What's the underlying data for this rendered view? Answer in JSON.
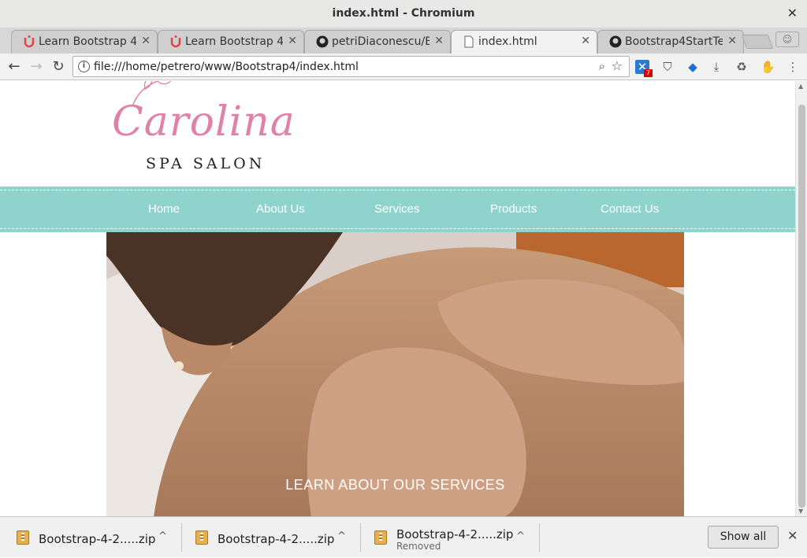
{
  "window": {
    "title": "index.html - Chromium",
    "close_glyph": "✕"
  },
  "tabs": [
    {
      "label": "Learn Bootstrap 4",
      "icon": "udemy-icon",
      "close": "✕"
    },
    {
      "label": "Learn Bootstrap 4",
      "icon": "udemy-icon",
      "close": "✕"
    },
    {
      "label": "petriDiaconescu/Bo",
      "icon": "github-icon",
      "close": "✕"
    },
    {
      "label": "index.html",
      "icon": "page-icon",
      "close": "✕",
      "active": true
    },
    {
      "label": "Bootstrap4StartTe",
      "icon": "github-icon",
      "close": "✕"
    }
  ],
  "toolbar": {
    "back": "←",
    "forward": "→",
    "reload": "↻",
    "url": "file:///home/petrero/www/Bootstrap4/index.html",
    "info": "i",
    "zoom": "⌕",
    "star": "☆",
    "ext_badge": "7",
    "menu": "⋮"
  },
  "page": {
    "logo_script": "Carolina",
    "logo_sub": "SPA SALON",
    "nav": [
      "Home",
      "About Us",
      "Services",
      "Products",
      "Contact Us"
    ],
    "hero_caption": "LEARN ABOUT OUR SERVICES"
  },
  "downloads": [
    {
      "name": "Bootstrap-4-2.....zip",
      "status": ""
    },
    {
      "name": "Bootstrap-4-2.....zip",
      "status": ""
    },
    {
      "name": "Bootstrap-4-2.....zip",
      "status": "Removed"
    }
  ],
  "shelf": {
    "show_all": "Show all",
    "close": "✕",
    "chevron": "^"
  },
  "colors": {
    "nav_bg": "#8fd4cc",
    "logo_pink": "#e082a6"
  }
}
